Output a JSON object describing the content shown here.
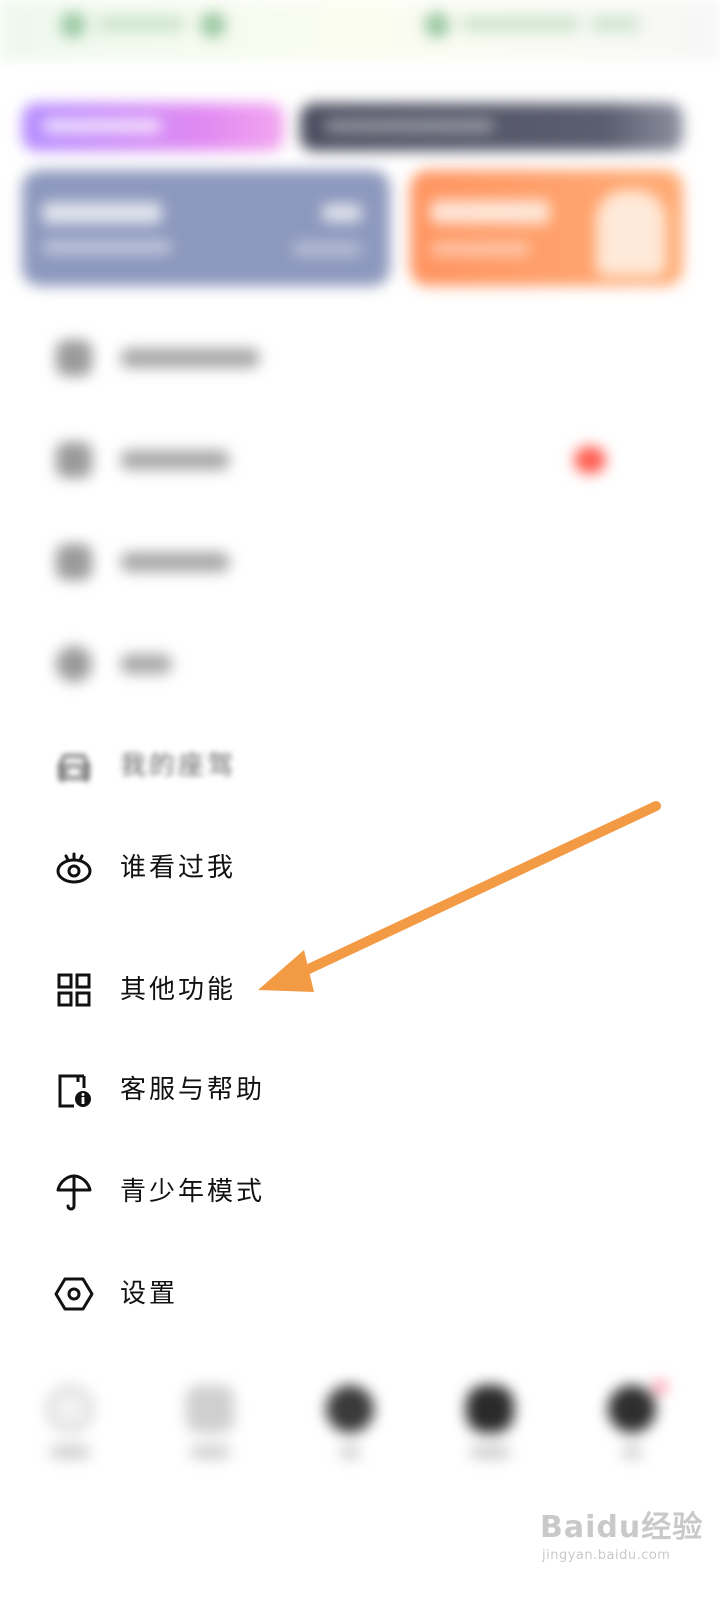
{
  "colors": {
    "accent_orange": "#F39A45",
    "banner_purple": "#B58CFF",
    "banner_dark": "#4C4E60",
    "card_blue": "#8C98BD",
    "card_orange": "#FF9460",
    "badge_red": "#FF5B4E",
    "text_primary": "#111111"
  },
  "menu": {
    "items": [
      {
        "label": "",
        "icon": "blurred-icon",
        "blurred": true
      },
      {
        "label": "",
        "icon": "blurred-icon",
        "blurred": true,
        "badge": true
      },
      {
        "label": "",
        "icon": "blurred-icon",
        "blurred": true
      },
      {
        "label": "",
        "icon": "blurred-icon",
        "blurred": true
      },
      {
        "label": "我的座驾",
        "icon": "car-icon"
      },
      {
        "label": "谁看过我",
        "icon": "eye-icon"
      },
      {
        "label": "其他功能",
        "icon": "grid-icon"
      },
      {
        "label": "客服与帮助",
        "icon": "help-doc-icon"
      },
      {
        "label": "青少年模式",
        "icon": "umbrella-icon"
      },
      {
        "label": "设置",
        "icon": "settings-hexagon-icon"
      }
    ]
  },
  "annotation": {
    "icon": "arrow-icon",
    "target": "其他功能"
  },
  "watermark": {
    "logo": "Baidu经验",
    "sub": "jingyan.baidu.com"
  }
}
